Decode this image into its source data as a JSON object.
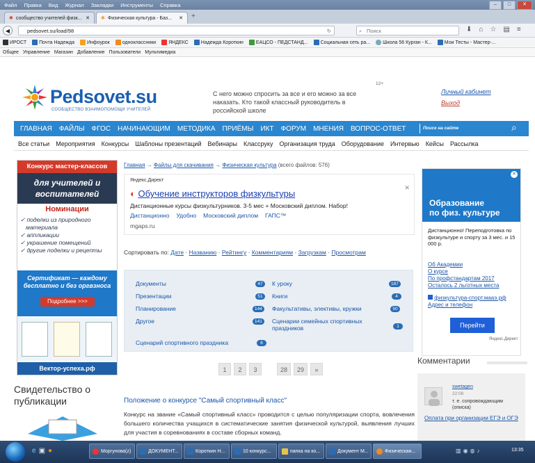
{
  "browser": {
    "menu": [
      "Файл",
      "Правка",
      "Вид",
      "Журнал",
      "Закладки",
      "Инструменты",
      "Справка"
    ],
    "tabs": [
      {
        "label": "сообщество учителей физк..."
      },
      {
        "label": "Физическая культура - Баз..."
      }
    ],
    "url": "pedsovet.su/load/98",
    "search_placeholder": "Поиск",
    "bookmarks": [
      "ИРОСТ",
      "Почта Надежда",
      "Инфоурок",
      "одноклассники",
      "ЯНДЕКС",
      "Надежда Короткин",
      "ЕАЦСО - ПЕДСТАНД...",
      "Социальная сеть ра...",
      "Школа 56 Курган - К...",
      "Мои Тесты - Мастер-..."
    ],
    "addon_menu": [
      "Общее",
      "Управление",
      "Магазин",
      "Добавление",
      "Пользователи",
      "Мультимедиа"
    ]
  },
  "header": {
    "logo_main": "Pedsovet.su",
    "logo_sub": "СООБЩЕСТВО ВЗАИМОПОМОЩИ УЧИТЕЛЕЙ",
    "slogan": "С него можно спросить за все и его можно за все наказать. Кто такой классный руководитель в российской школе",
    "age": "12+",
    "cabinet": "Личный кабинет",
    "exit": "Выход"
  },
  "main_nav": [
    "ГЛАВНАЯ",
    "ФАЙЛЫ",
    "ФГОС",
    "НАЧИНАЮЩИМ",
    "МЕТОДИКА",
    "ПРИЁМЫ",
    "ИКТ",
    "ФОРУМ",
    "МНЕНИЯ",
    "ВОПРОС-ОТВЕТ"
  ],
  "nav_search_placeholder": "Поиск на сайте",
  "sub_nav": [
    "Все статьи",
    "Мероприятия",
    "Конкурсы",
    "Шаблоны презентаций",
    "Вебинары",
    "Классруку",
    "Организация труда",
    "Оборудование",
    "Интервью",
    "Кейсы",
    "Рассылка"
  ],
  "left_banner": {
    "top": "Конкурс мастер-классов",
    "head1": "для учителей и",
    "head2": "воспитателей",
    "nominations": "Номинации",
    "items": [
      "✓ поделки из природного",
      "материала",
      "✓ аппликации",
      "✓ украшение помещений",
      "✓ другие поделки и рецепты"
    ],
    "cert1": "Сертификат — каждому",
    "cert2": "бесплатно и без оргвзноса",
    "more": "Подробнее >>>",
    "footer": "Вектор-успеха.рф"
  },
  "certificate_title": "Свидетельство о публикации",
  "breadcrumbs": {
    "home": "Главная",
    "sep": "→",
    "files": "Файлы для скачивания",
    "current": "Физическая культура",
    "count": "(всего файлов: 576)"
  },
  "direct_ad": {
    "label": "Яндекс.Директ",
    "title": "Обучение инструкторов физкультуры",
    "text": "Дистанционные курсы физкультурников. 3-5 мес + Московский диплом. Набор!",
    "links": [
      "Дистанционно",
      "Удобно",
      "Московский диплом",
      "ГАПС™"
    ],
    "domain": "mgaps.ru"
  },
  "sort": {
    "label": "Сортировать по:",
    "options": [
      "Дате",
      "Названию",
      "Рейтингу",
      "Комментариям",
      "Загрузкам",
      "Просмотрам"
    ]
  },
  "categories": [
    {
      "name": "Документы",
      "count": "47"
    },
    {
      "name": "Презентации",
      "count": "51"
    },
    {
      "name": "Планирование",
      "count": "144"
    },
    {
      "name": "Другое",
      "count": "141"
    },
    {
      "name": "Сценарий спортивного праздника",
      "count": "6"
    },
    {
      "name": "К уроку",
      "count": "187"
    },
    {
      "name": "Книги",
      "count": "4"
    },
    {
      "name": "Факультативы, элективы, кружки",
      "count": "50"
    },
    {
      "name": "Сценарии семейных спортивных",
      "name2": "праздников",
      "count": "1"
    }
  ],
  "pager": [
    "1",
    "2",
    "3",
    "28",
    "29",
    "»"
  ],
  "article": {
    "title": "Положение о конкурсе \"Самый спортивный класс\"",
    "text": "Конкурс на звание «Самый спортивный класс» проводится с целью популяризации спорта, вовлечения большего количества учащихся в систематические занятия физической культурой, выявления лучших для участия в соревнованиях в составе сборных команд."
  },
  "right_ad": {
    "title1": "Образование",
    "title2": "по физ. культуре",
    "text": "Дистанционно! Переподготовка по физкультуре и спорту за 3 мес. и 15 000 р.",
    "links": [
      "Об Академии",
      "О курсе",
      "По профстандартам 2017",
      "Осталось 2 льготных места"
    ],
    "site": "физкультура-спорт.мааэ.рф",
    "address": "Адрес и телефон",
    "button": "Перейти",
    "footer": "Яндекс.Директ"
  },
  "comments": {
    "title": "Комментарии",
    "user": "swetagen",
    "time": "22:08",
    "text": "т. е. сопровождающим (описка)",
    "link": "Оплата при организации ЕГЭ и ОГЭ"
  },
  "taskbar": {
    "items": [
      "Моргунова(z)",
      "ДОКУМЕНТ...",
      "Короткин Н...",
      "10 конкурс...",
      "папка на ко...",
      "Документ M...",
      "Физическая..."
    ],
    "clock": "13:35"
  },
  "colors": {
    "brand_blue": "#2a86cf",
    "link_blue": "#1a55a8",
    "banner_red": "#d43a2a"
  }
}
